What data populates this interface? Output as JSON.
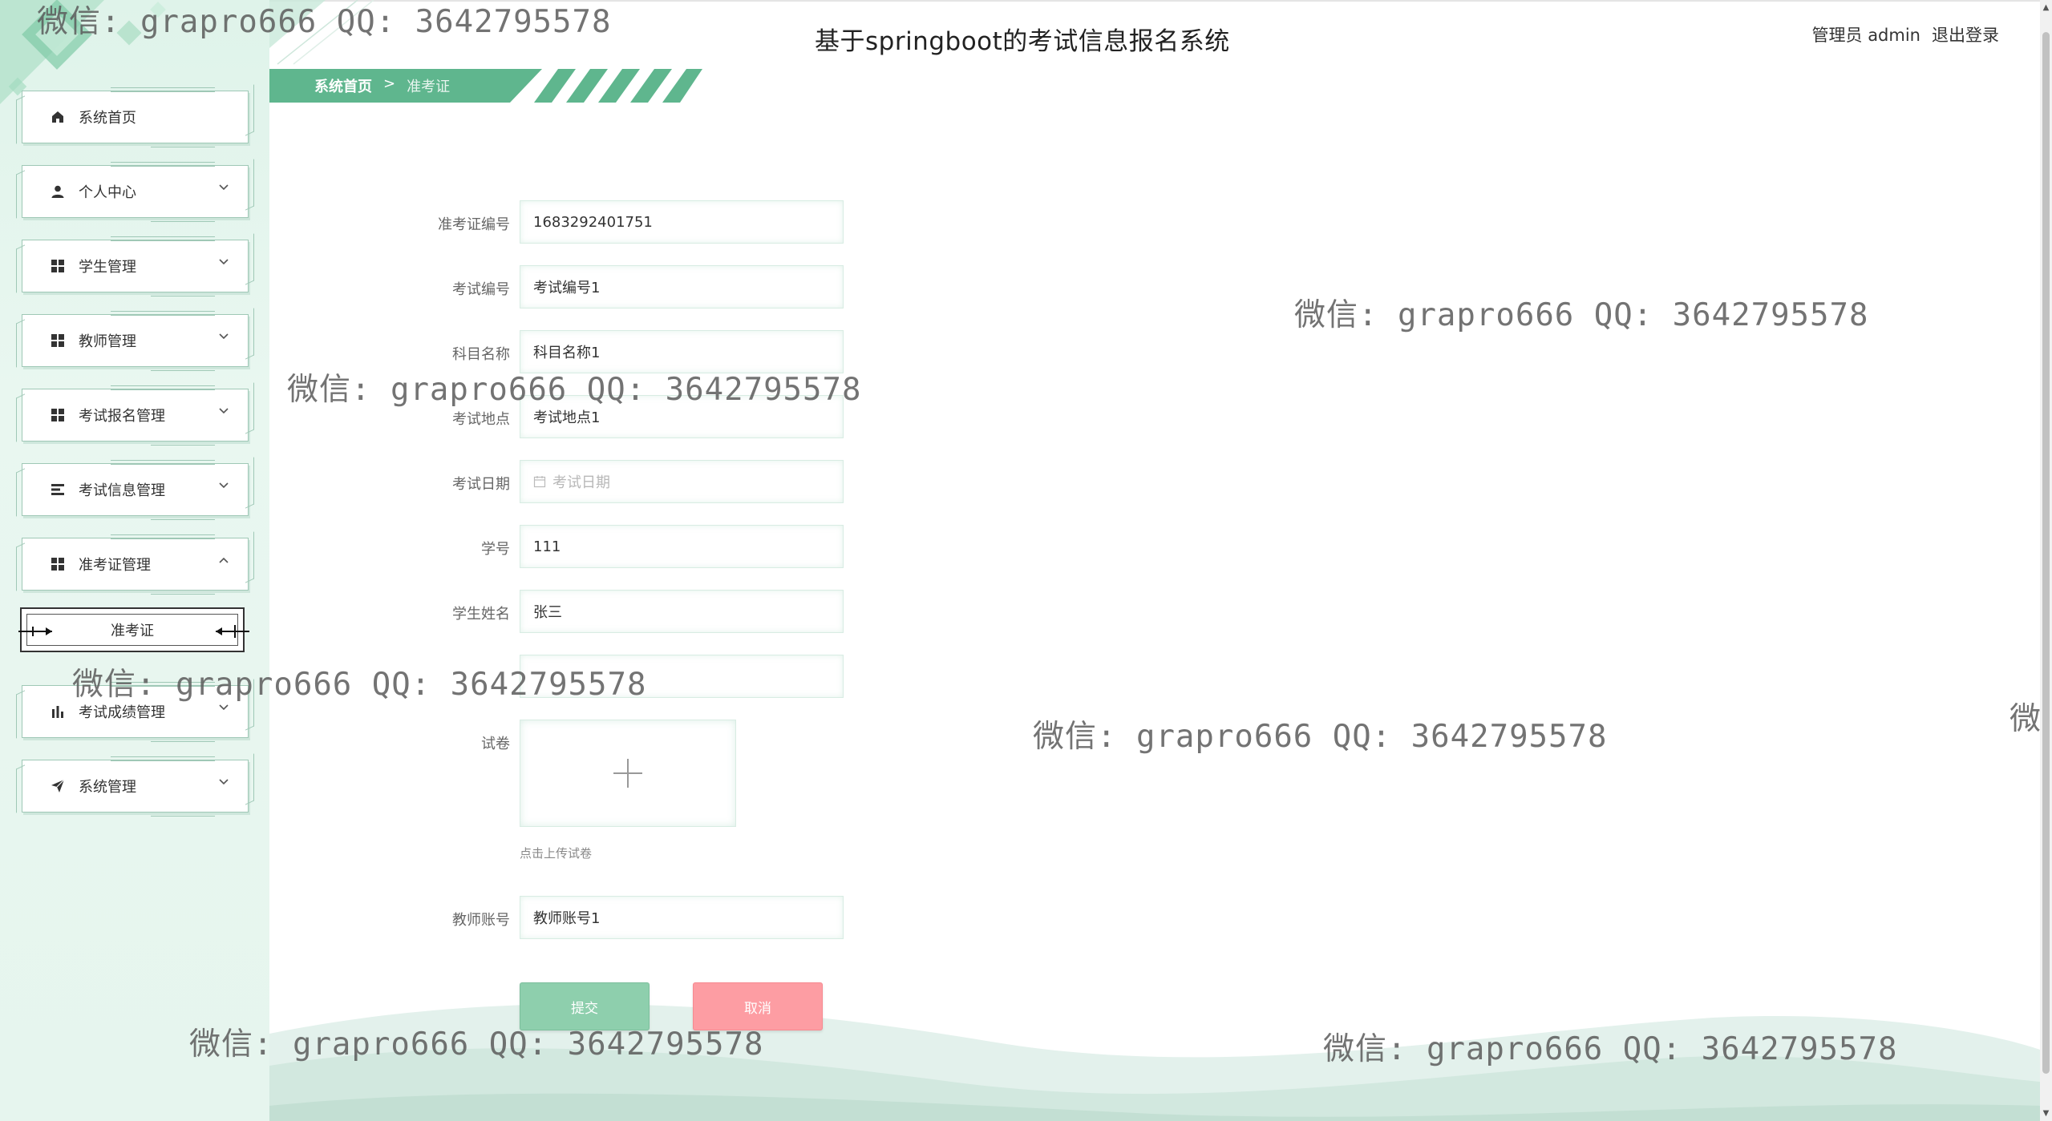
{
  "app": {
    "title": "基于springboot的考试信息报名系统",
    "user_label": "管理员 admin",
    "logout_label": "退出登录"
  },
  "breadcrumb": {
    "home": "系统首页",
    "separator": ">",
    "current": "准考证"
  },
  "sidebar": {
    "items": [
      {
        "label": "系统首页",
        "icon": "home-icon",
        "expandable": false
      },
      {
        "label": "个人中心",
        "icon": "user-icon",
        "expandable": true,
        "state": "collapsed"
      },
      {
        "label": "学生管理",
        "icon": "grid-icon",
        "expandable": true,
        "state": "collapsed"
      },
      {
        "label": "教师管理",
        "icon": "grid-icon",
        "expandable": true,
        "state": "collapsed"
      },
      {
        "label": "考试报名管理",
        "icon": "grid-icon",
        "expandable": true,
        "state": "collapsed"
      },
      {
        "label": "考试信息管理",
        "icon": "list-icon",
        "expandable": true,
        "state": "collapsed"
      },
      {
        "label": "准考证管理",
        "icon": "grid-icon",
        "expandable": true,
        "state": "expanded"
      },
      {
        "label": "考试成绩管理",
        "icon": "bar-chart-icon",
        "expandable": true,
        "state": "collapsed"
      },
      {
        "label": "系统管理",
        "icon": "send-icon",
        "expandable": true,
        "state": "collapsed"
      }
    ],
    "submenu_active": "准考证"
  },
  "form": {
    "fields": [
      {
        "label": "准考证编号",
        "value": "1683292401751",
        "placeholder": ""
      },
      {
        "label": "考试编号",
        "value": "考试编号1",
        "placeholder": ""
      },
      {
        "label": "科目名称",
        "value": "科目名称1",
        "placeholder": ""
      },
      {
        "label": "考试地点",
        "value": "考试地点1",
        "placeholder": ""
      },
      {
        "label": "考试日期",
        "value": "",
        "placeholder": "考试日期"
      },
      {
        "label": "学号",
        "value": "111",
        "placeholder": ""
      },
      {
        "label": "学生姓名",
        "value": "张三",
        "placeholder": ""
      },
      {
        "label": "",
        "value": "",
        "placeholder": ""
      }
    ],
    "upload": {
      "label": "试卷",
      "tip": "点击上传试卷"
    },
    "teacher_field": {
      "label": "教师账号",
      "value": "教师账号1"
    },
    "submit_label": "提交",
    "cancel_label": "取消"
  },
  "watermark": {
    "text": "微信: grapro666 QQ: 3642795578"
  },
  "colors": {
    "accent_green": "#5fb68e",
    "submit_green": "#8ecfad",
    "cancel_pink": "#fd9da3",
    "sidebar_bg": "#e3f4ec"
  }
}
